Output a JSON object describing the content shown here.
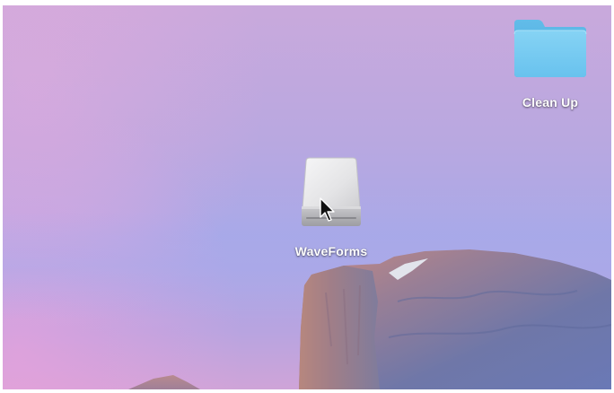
{
  "desktop": {
    "icons": [
      {
        "label": "Clean Up",
        "type": "folder-icon",
        "color": "#6fc7ee"
      },
      {
        "label": "WaveForms",
        "type": "external-drive-icon",
        "color": "#e6e6e8"
      }
    ]
  },
  "cursor": {
    "type": "arrow-pointer-icon"
  }
}
